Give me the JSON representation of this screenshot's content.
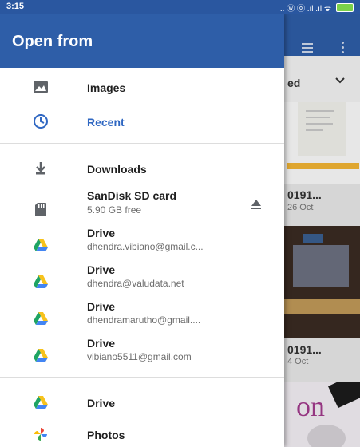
{
  "status_bar": {
    "time": "3:15",
    "icons_text": "... ⓦ ⓞ .ıl .ıl ᯤ"
  },
  "drawer": {
    "title": "Open from",
    "items": [
      {
        "label": "Images",
        "icon": "image-icon"
      },
      {
        "label": "Recent",
        "icon": "clock-icon"
      },
      {
        "label": "Downloads",
        "icon": "download-icon"
      },
      {
        "label": "SanDisk SD card",
        "sub": "5.90 GB free",
        "icon": "sd-card-icon",
        "action_icon": "eject-icon"
      },
      {
        "label": "Drive",
        "sub": "dhendra.vibiano@gmail.c...",
        "icon": "google-drive-icon"
      },
      {
        "label": "Drive",
        "sub": "dhendra@valudata.net",
        "icon": "google-drive-icon"
      },
      {
        "label": "Drive",
        "sub": "dhendramarutho@gmail....",
        "icon": "google-drive-icon"
      },
      {
        "label": "Drive",
        "sub": "vibiano5511@gmail.com",
        "icon": "google-drive-icon"
      },
      {
        "label": "Drive",
        "icon": "google-drive-icon"
      },
      {
        "label": "Photos",
        "icon": "google-photos-icon"
      }
    ]
  },
  "background": {
    "sort_label": "ed",
    "cards": [
      {
        "title": "0191...",
        "sub": "26 Oct"
      },
      {
        "title": "0191...",
        "sub": "4 Oct"
      },
      {
        "title": "on"
      }
    ]
  },
  "colors": {
    "primary": "#2e5ea8",
    "recent_accent": "#2f67c2",
    "battery": "#7bd14a"
  }
}
